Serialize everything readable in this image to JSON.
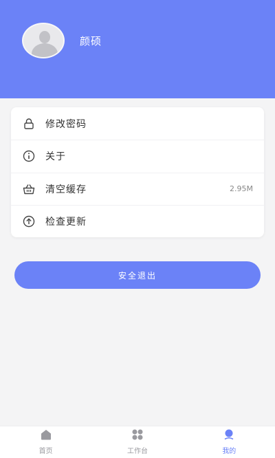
{
  "profile": {
    "name": "颜硕"
  },
  "menu": {
    "items": [
      {
        "label": "修改密码",
        "icon": "lock-icon",
        "value": ""
      },
      {
        "label": "关于",
        "icon": "info-icon",
        "value": ""
      },
      {
        "label": "清空缓存",
        "icon": "basket-icon",
        "value": "2.95M"
      },
      {
        "label": "检查更新",
        "icon": "upload-circle-icon",
        "value": ""
      }
    ]
  },
  "logout": {
    "label": "安全退出"
  },
  "tabbar": {
    "tabs": [
      {
        "label": "首页",
        "icon": "home-icon",
        "active": false
      },
      {
        "label": "工作台",
        "icon": "grid-icon",
        "active": false
      },
      {
        "label": "我的",
        "icon": "user-icon",
        "active": true
      }
    ]
  },
  "colors": {
    "accent": "#6b82f7",
    "background": "#f4f4f5",
    "inactive_tab": "#9a9a9f"
  }
}
